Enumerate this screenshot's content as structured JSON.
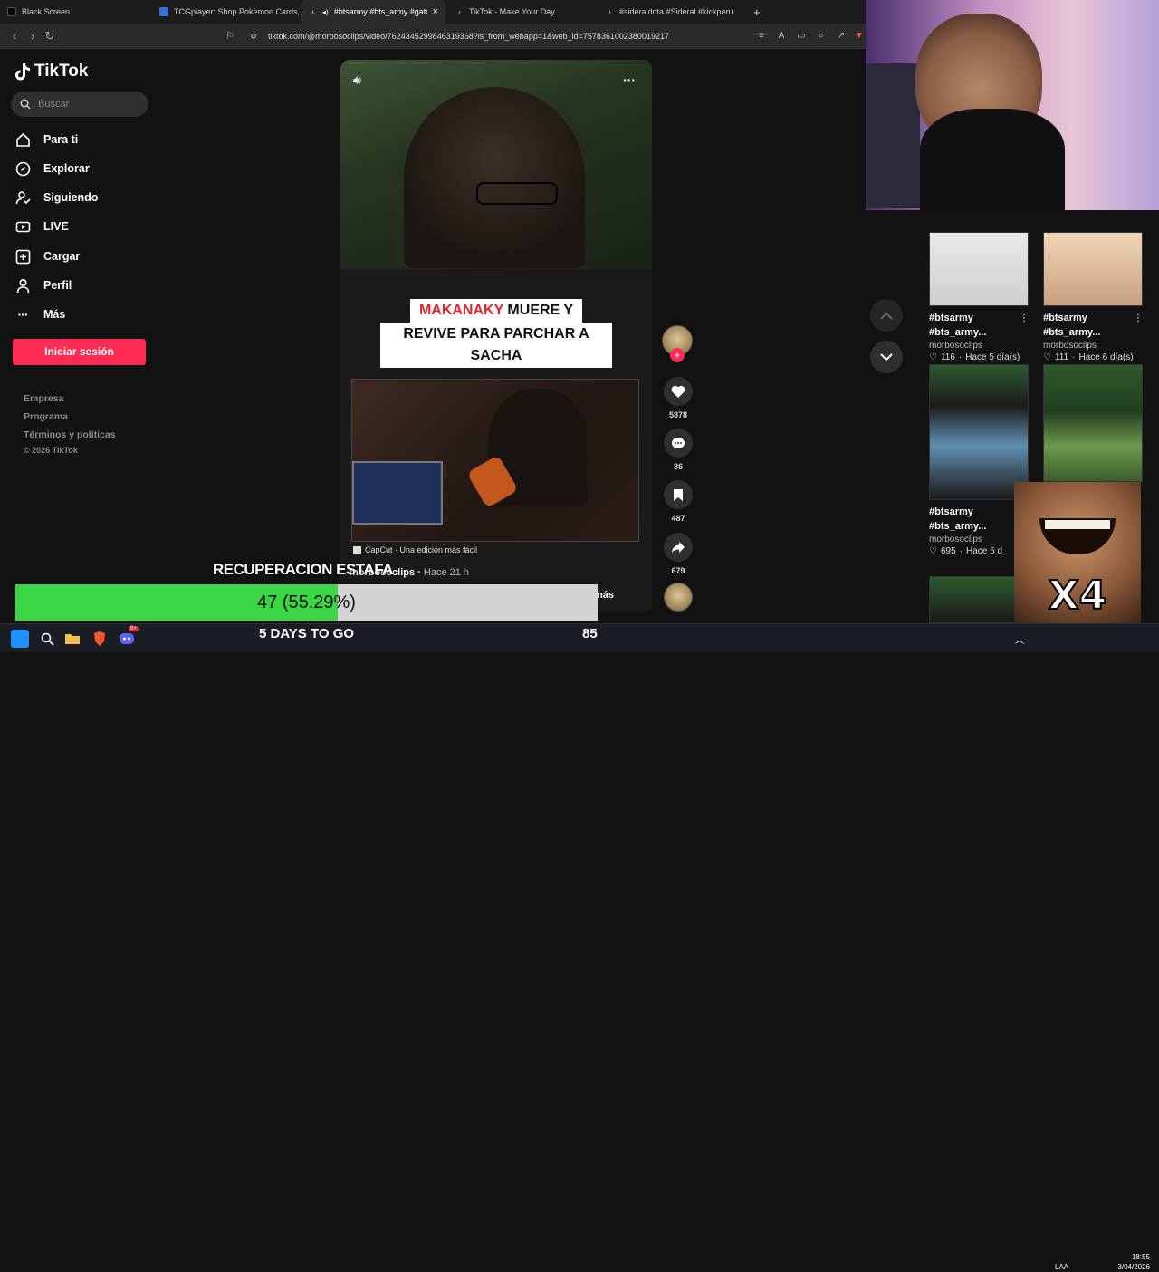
{
  "browser": {
    "tabs": [
      {
        "title": "Black Screen",
        "icon": "black-square-icon",
        "active": false
      },
      {
        "title": "TCGplayer: Shop Pokemon Cards, Pa",
        "icon": "tcgplayer-icon",
        "active": false
      },
      {
        "title": "#btsarmy #bts_army #gatchu",
        "icon": "tiktok-icon",
        "active": true
      },
      {
        "title": "TikTok - Make Your Day",
        "icon": "tiktok-icon",
        "active": false
      },
      {
        "title": "#sideraldota #Sideral #kickperu | side",
        "icon": "tiktok-icon",
        "active": false
      }
    ],
    "new_tab": "+",
    "close_tab": "×",
    "url": "tiktok.com/@morbosoclips/video/7624345299846319368?is_from_webapp=1&web_id=7578361002380019217"
  },
  "sidebar": {
    "logo": "TikTok",
    "search_placeholder": "Buscar",
    "nav": [
      {
        "label": "Para ti",
        "icon": "home-icon"
      },
      {
        "label": "Explorar",
        "icon": "compass-icon"
      },
      {
        "label": "Siguiendo",
        "icon": "following-icon"
      },
      {
        "label": "LIVE",
        "icon": "live-icon"
      },
      {
        "label": "Cargar",
        "icon": "upload-icon"
      },
      {
        "label": "Perfil",
        "icon": "profile-icon"
      },
      {
        "label": "Más",
        "icon": "more-icon"
      }
    ],
    "login_button": "Iniciar sesión",
    "footer": [
      "Empresa",
      "Programa",
      "Términos y políticas",
      "© 2026 TikTok"
    ]
  },
  "video": {
    "caption_highlight": "MAKANAKY",
    "caption_line1_rest": " MUERE Y",
    "caption_line2": "REVIVE PARA PARCHAR A SACHA",
    "capcut": "CapCut · Una edición más fácil",
    "author": "morbosoclips",
    "time": "Hace 21 h",
    "more": "más",
    "actions": {
      "likes": "5878",
      "comments": "86",
      "saves": "487",
      "shares": "679"
    }
  },
  "related": [
    {
      "title1": "#btsarmy",
      "title2": "#bts_army...",
      "author": "morbosoclips",
      "likes": "116",
      "age": "Hace 5 día(s)"
    },
    {
      "title1": "#btsarmy",
      "title2": "#bts_army...",
      "author": "morbosoclips",
      "likes": "111",
      "age": "Hace 6 día(s)"
    },
    {
      "title1": "#btsarmy",
      "title2": "#bts_army...",
      "author": "morbosoclips",
      "likes": "695",
      "age": "Hace 5 d"
    }
  ],
  "overlay": {
    "goal_title": "RECUPERACION ESTAFA",
    "goal_text": "47 (55.29%)",
    "goal_progress": 0.5529,
    "days": "5 DAYS TO GO",
    "count": "85",
    "meme_text": "X4"
  },
  "taskbar": {
    "lang": "LAA",
    "time": "18:55",
    "date": "3/04/2026",
    "discord_badge": "9+"
  },
  "colors": {
    "tiktok_red": "#fe2c55",
    "goal_green": "#3bd645"
  }
}
